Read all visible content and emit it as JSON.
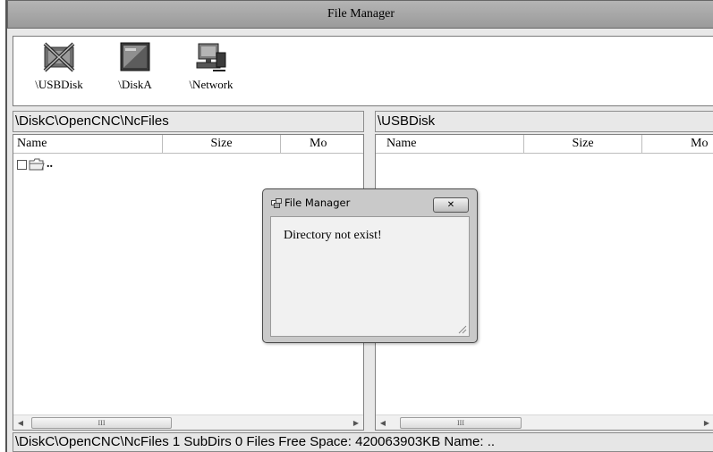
{
  "window": {
    "title": "File Manager"
  },
  "drives": [
    {
      "label": "\\USBDisk",
      "icon": "usb-disk-unavailable-icon"
    },
    {
      "label": "\\DiskA",
      "icon": "disk-a-icon"
    },
    {
      "label": "\\Network",
      "icon": "network-drive-icon"
    }
  ],
  "left_pane": {
    "path": "\\DiskC\\OpenCNC\\NcFiles",
    "columns": [
      "Name",
      "Size",
      "Mo"
    ],
    "rows": [
      {
        "name": ".."
      }
    ]
  },
  "right_pane": {
    "path": "\\USBDisk",
    "columns": [
      "Name",
      "Size",
      "Mo"
    ],
    "rows": []
  },
  "scroll": {
    "thumb_grip": "III"
  },
  "status": {
    "text": "\\DiskC\\OpenCNC\\NcFiles 1 SubDirs 0 Files Free Space: 420063903KB  Name: .."
  },
  "dialog": {
    "title": "File Manager",
    "close_label": "✕",
    "message": "Directory not exist!"
  }
}
